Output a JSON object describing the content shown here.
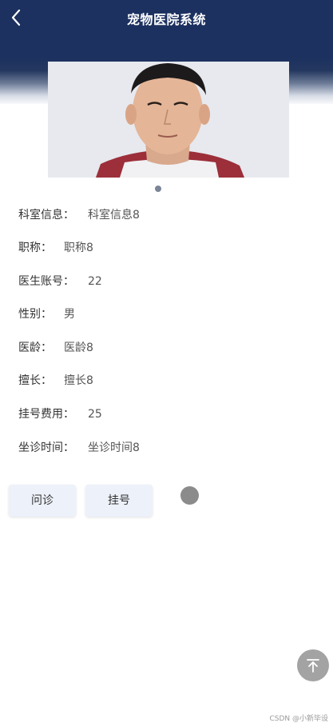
{
  "header": {
    "title": "宠物医院系统",
    "background_color": "#1d3160",
    "back_icon": "chevron-left-icon"
  },
  "doctor": {
    "photo_icon": "doctor-portrait-image",
    "carousel_count": 1,
    "fields": [
      {
        "label": "科室信息：",
        "value": "科室信息8"
      },
      {
        "label": "职称：",
        "value": "职称8"
      },
      {
        "label": "医生账号：",
        "value": "22"
      },
      {
        "label": "性别：",
        "value": "男"
      },
      {
        "label": "医龄：",
        "value": "医龄8"
      },
      {
        "label": "擅长：",
        "value": "擅长8"
      },
      {
        "label": "挂号费用：",
        "value": "25"
      },
      {
        "label": "坐诊时间：",
        "value": "坐诊时间8"
      }
    ]
  },
  "actions": {
    "consult_label": "问诊",
    "register_label": "挂号"
  },
  "back_to_top_icon": "arrow-up-to-top-icon",
  "watermark": "CSDN @小新毕设"
}
